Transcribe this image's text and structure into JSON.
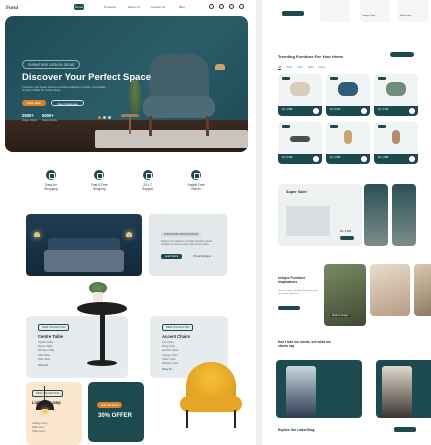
{
  "brand": {
    "logo": "Furni"
  },
  "nav": {
    "links": [
      "Home",
      "Products",
      "About Us",
      "Contact Us",
      "Blog"
    ]
  },
  "hero": {
    "badge": "FURNITURE DESIGN IDEAS",
    "title": "Discover Your Perfect Space",
    "desc": "Transform your space with our exclusive collection of stylish, comfortable furniture crafted for modern living.",
    "primary_btn": "Shop Now",
    "secondary_btn": "View Catalogue",
    "stats": [
      {
        "value": "2500+",
        "label": "Unique Styles"
      },
      {
        "value": "5000+",
        "label": "Happy Clients"
      }
    ]
  },
  "features": [
    {
      "icon": "truck-icon",
      "label_1": "Easy for",
      "label_2": "Shopping"
    },
    {
      "icon": "box-icon",
      "label_1": "Fast & Free",
      "label_2": "Shipping"
    },
    {
      "icon": "headset-icon",
      "label_1": "24 x 7",
      "label_2": "Support"
    },
    {
      "icon": "return-icon",
      "label_1": "Hassel Free",
      "label_2": "Return"
    }
  ],
  "offer": {
    "tag": "FURNITURE DESIGN IDEAS",
    "text": "Explore our collection of modern furniture pieces designed to elevate every room of your home.",
    "primary_btn": "Learn More",
    "secondary_btn": "Virtual Designer"
  },
  "collection_center": {
    "tag": "NEW COLLECTION",
    "title": "Centre Table",
    "items": [
      "Square Table",
      "Round Table",
      "Wooden Table",
      "Sofa Table",
      "Side Table"
    ],
    "link": "Shop All"
  },
  "collection_accent": {
    "tag": "NEW COLLECTION",
    "title": "Accent Chairs",
    "items": [
      "Arm Chair",
      "Wing Chair",
      "Recliner Chair",
      "Lounge Chair",
      "Office Chair",
      "Rocking Chair"
    ],
    "link": "Shop All"
  },
  "collection_lighting": {
    "tag": "NEW COLLECTION",
    "title": "Lighting Lamp",
    "items": [
      "Ceiling Lamp",
      "Wall Lamp",
      "Table Lamp"
    ]
  },
  "discount": {
    "pill": "Only this Week",
    "title": "30% OFFER"
  },
  "right_top": {
    "items": [
      "Lounge Chair",
      "White Chair"
    ]
  },
  "trending": {
    "title": "Trending Furniture For Your Home",
    "button": "View All Product",
    "tabs": [
      "All",
      "Chair",
      "Sofa",
      "Table",
      "Lamp"
    ],
    "products": [
      {
        "price": "Rs. 4,599"
      },
      {
        "price": "Rs. 6,200"
      },
      {
        "price": "Rs. 3,799"
      },
      {
        "price": "Rs. 5,499"
      },
      {
        "price": "Rs. 2,999"
      },
      {
        "price": "Rs. 1,899"
      }
    ]
  },
  "sale": {
    "title": "Super Sale!",
    "price": "Rs. 2,999",
    "button": "Shop Now"
  },
  "inspiration": {
    "title": "Unique Furniture Inspirations",
    "text": "Discover unique designs that inspire your next home makeover.",
    "button": "Explore More",
    "card_label": "Modern Design"
  },
  "blog": {
    "title": "Don't take our words, see what our clients say",
    "explore": "Explore Our Latest Blog",
    "button": "View All Blog"
  },
  "colors": {
    "accent": "#1d4a4f",
    "orange": "#d9822b",
    "yellow": "#f2b531"
  }
}
